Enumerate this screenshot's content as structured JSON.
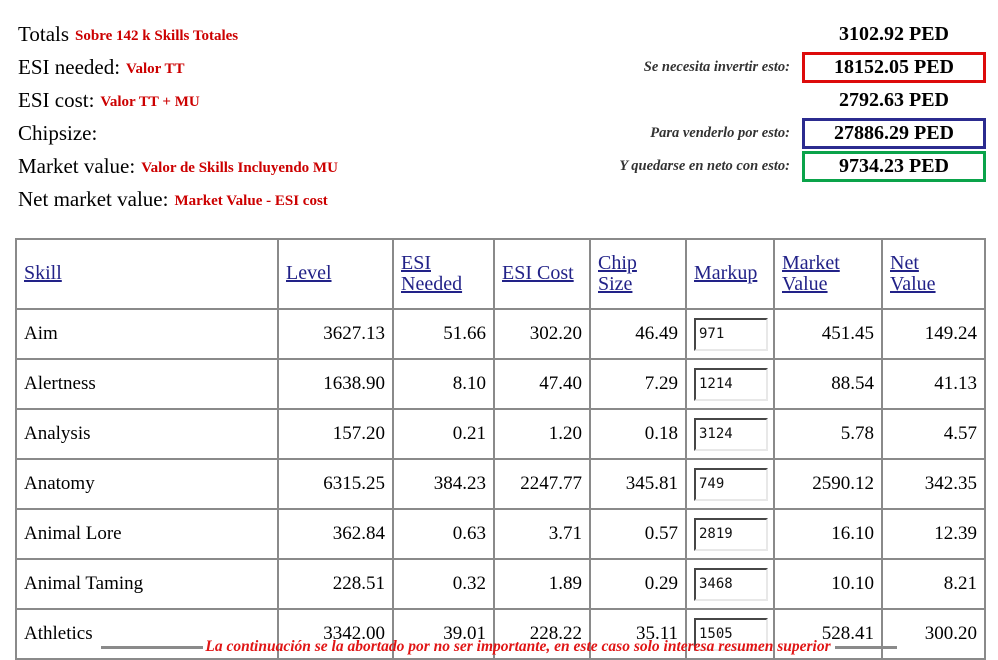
{
  "summary": {
    "rows": [
      {
        "label": "Totals",
        "note": "Sobre 142 k Skills Totales"
      },
      {
        "label": "ESI needed:",
        "note": "Valor TT"
      },
      {
        "label": "ESI cost:",
        "note": "Valor TT + MU"
      },
      {
        "label": "Chipsize:",
        "note": ""
      },
      {
        "label": "Market value:",
        "note": "Valor de Skills Incluyendo MU"
      },
      {
        "label": "Net market value:",
        "note": "Market Value - ESI cost"
      }
    ],
    "values": [
      {
        "caption": "",
        "amount": "3102.92 PED",
        "box": "none"
      },
      {
        "caption": "Se necesita invertir esto:",
        "amount": "18152.05 PED",
        "box": "red"
      },
      {
        "caption": "",
        "amount": "2792.63 PED",
        "box": "none"
      },
      {
        "caption": "Para venderlo por esto:",
        "amount": "27886.29 PED",
        "box": "blue"
      },
      {
        "caption": "Y quedarse en neto con esto:",
        "amount": "9734.23 PED",
        "box": "green"
      }
    ],
    "colors": {
      "note_red": "#cc0000",
      "box_red": "#dd0b0b",
      "box_blue": "#2b2b8f",
      "box_green": "#0aa34a",
      "header_link_blue": "#222288"
    }
  },
  "table": {
    "headers": [
      {
        "lines": [
          "Skill"
        ]
      },
      {
        "lines": [
          "Level"
        ]
      },
      {
        "lines": [
          "ESI",
          "Needed"
        ]
      },
      {
        "lines": [
          "ESI Cost"
        ]
      },
      {
        "lines": [
          "Chip",
          "Size"
        ]
      },
      {
        "lines": [
          "Markup"
        ]
      },
      {
        "lines": [
          "Market",
          "Value"
        ]
      },
      {
        "lines": [
          "Net",
          "Value"
        ]
      }
    ],
    "rows": [
      {
        "skill": "Aim",
        "level": "3627.13",
        "esi_needed": "51.66",
        "esi_cost": "302.20",
        "chip_size": "46.49",
        "markup": "971",
        "market_value": "451.45",
        "net_value": "149.24"
      },
      {
        "skill": "Alertness",
        "level": "1638.90",
        "esi_needed": "8.10",
        "esi_cost": "47.40",
        "chip_size": "7.29",
        "markup": "1214",
        "market_value": "88.54",
        "net_value": "41.13"
      },
      {
        "skill": "Analysis",
        "level": "157.20",
        "esi_needed": "0.21",
        "esi_cost": "1.20",
        "chip_size": "0.18",
        "markup": "3124",
        "market_value": "5.78",
        "net_value": "4.57"
      },
      {
        "skill": "Anatomy",
        "level": "6315.25",
        "esi_needed": "384.23",
        "esi_cost": "2247.77",
        "chip_size": "345.81",
        "markup": "749",
        "market_value": "2590.12",
        "net_value": "342.35"
      },
      {
        "skill": "Animal Lore",
        "level": "362.84",
        "esi_needed": "0.63",
        "esi_cost": "3.71",
        "chip_size": "0.57",
        "markup": "2819",
        "market_value": "16.10",
        "net_value": "12.39"
      },
      {
        "skill": "Animal Taming",
        "level": "228.51",
        "esi_needed": "0.32",
        "esi_cost": "1.89",
        "chip_size": "0.29",
        "markup": "3468",
        "market_value": "10.10",
        "net_value": "8.21"
      },
      {
        "skill": "Athletics",
        "level": "3342.00",
        "esi_needed": "39.01",
        "esi_cost": "228.22",
        "chip_size": "35.11",
        "markup": "1505",
        "market_value": "528.41",
        "net_value": "300.20"
      }
    ]
  },
  "footer": {
    "note": "La continuación se la abortado por no ser importante, en este caso solo interesa resumen superior"
  }
}
